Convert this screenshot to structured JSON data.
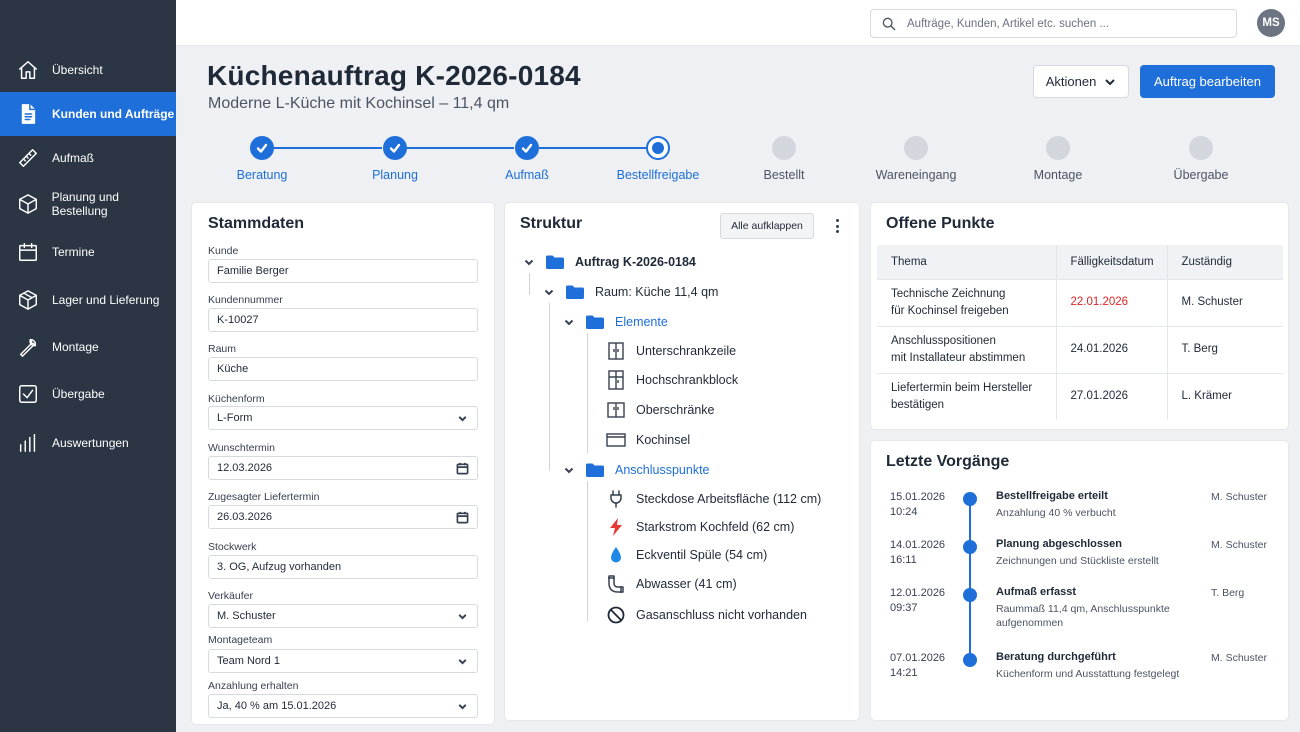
{
  "sidebar": {
    "items": [
      {
        "label": "Übersicht",
        "icon": "home-icon",
        "active": false
      },
      {
        "label": "Kunden und Aufträge",
        "icon": "document-icon",
        "active": true
      },
      {
        "label": "Aufmaß",
        "icon": "ruler-icon",
        "active": false
      },
      {
        "label": "Planung und Bestellung",
        "icon": "cube-icon",
        "active": false
      },
      {
        "label": "Termine",
        "icon": "calendar-icon",
        "active": false
      },
      {
        "label": "Lager und Lieferung",
        "icon": "box-icon",
        "active": false
      },
      {
        "label": "Montage",
        "icon": "wrench-icon",
        "active": false
      },
      {
        "label": "Übergabe",
        "icon": "checkbox-icon",
        "active": false
      },
      {
        "label": "Auswertungen",
        "icon": "bar-chart-icon",
        "active": false
      }
    ]
  },
  "topbar": {
    "search_placeholder": "Aufträge, Kunden, Artikel etc. suchen ...",
    "avatar_initials": "MS"
  },
  "header": {
    "title": "Küchenauftrag K-2026-0184",
    "subtitle": "Moderne L-Küche mit Kochinsel – 11,4 qm",
    "actions_label": "Aktionen",
    "edit_label": "Auftrag bearbeiten"
  },
  "steps": [
    {
      "label": "Beratung",
      "state": "done"
    },
    {
      "label": "Planung",
      "state": "done"
    },
    {
      "label": "Aufmaß",
      "state": "done"
    },
    {
      "label": "Bestellfreigabe",
      "state": "current"
    },
    {
      "label": "Bestellt",
      "state": "todo"
    },
    {
      "label": "Wareneingang",
      "state": "todo"
    },
    {
      "label": "Montage",
      "state": "todo"
    },
    {
      "label": "Übergabe",
      "state": "todo"
    }
  ],
  "stammdaten": {
    "title": "Stammdaten",
    "fields": [
      {
        "label": "Kunde",
        "value": "Familie Berger",
        "kind": "text"
      },
      {
        "label": "Kundennummer",
        "value": "K-10027",
        "kind": "text"
      },
      {
        "label": "Raum",
        "value": "Küche",
        "kind": "text"
      },
      {
        "label": "Küchenform",
        "value": "L-Form",
        "kind": "select"
      },
      {
        "label": "Wunschtermin",
        "value": "12.03.2026",
        "kind": "date"
      },
      {
        "label": "Zugesagter Liefertermin",
        "value": "26.03.2026",
        "kind": "date"
      },
      {
        "label": "Stockwerk",
        "value": "3. OG, Aufzug vorhanden",
        "kind": "text"
      },
      {
        "label": "Verkäufer",
        "value": "M. Schuster",
        "kind": "select"
      },
      {
        "label": "Montageteam",
        "value": "Team Nord 1",
        "kind": "select"
      },
      {
        "label": "Anzahlung erhalten",
        "value": "Ja, 40 % am 15.01.2026",
        "kind": "select"
      }
    ]
  },
  "struktur": {
    "title": "Struktur",
    "expand_label": "Alle aufklappen",
    "root": "Auftrag K-2026-0184",
    "room": "Raum: Küche 11,4 qm",
    "elemente": {
      "label": "Elemente",
      "items": [
        {
          "label": "Unterschrankzeile",
          "icon": "cabinet-icon"
        },
        {
          "label": "Hochschrankblock",
          "icon": "tall-cabinet-icon"
        },
        {
          "label": "Oberschränke",
          "icon": "wall-cabinet-icon"
        },
        {
          "label": "Kochinsel",
          "icon": "island-icon"
        }
      ]
    },
    "anschluss": {
      "label": "Anschlusspunkte",
      "items": [
        {
          "label": "Steckdose Arbeitsfläche (112 cm)",
          "icon": "plug-icon"
        },
        {
          "label": "Starkstrom Kochfeld (62 cm)",
          "icon": "lightning-icon"
        },
        {
          "label": "Eckventil Spüle (54 cm)",
          "icon": "water-drop-icon"
        },
        {
          "label": "Abwasser (41 cm)",
          "icon": "drain-pipe-icon"
        },
        {
          "label": "Gasanschluss nicht vorhanden",
          "icon": "prohibited-icon"
        }
      ]
    }
  },
  "offene_punkte": {
    "title": "Offene Punkte",
    "columns": [
      "Thema",
      "Fälligkeitsdatum",
      "Zuständig"
    ],
    "rows": [
      {
        "thema_1": "Technische Zeichnung",
        "thema_2": "für Kochinsel freigeben",
        "datum": "22.01.2026",
        "zustaendig": "M. Schuster",
        "overdue": true
      },
      {
        "thema_1": "Anschlusspositionen",
        "thema_2": "mit Installateur abstimmen",
        "datum": "24.01.2026",
        "zustaendig": "T. Berg",
        "overdue": false
      },
      {
        "thema_1": "Liefertermin beim Hersteller",
        "thema_2": "bestätigen",
        "datum": "27.01.2026",
        "zustaendig": "L. Krämer",
        "overdue": false
      }
    ]
  },
  "letzte_vorgaenge": {
    "title": "Letzte Vorgänge",
    "items": [
      {
        "date": "15.01.2026",
        "time": "10:24",
        "title": "Bestellfreigabe erteilt",
        "desc": "Anzahlung 40 % verbucht",
        "user": "M. Schuster"
      },
      {
        "date": "14.01.2026",
        "time": "16:11",
        "title": "Planung abgeschlossen",
        "desc": "Zeichnungen und Stückliste erstellt",
        "user": "M. Schuster"
      },
      {
        "date": "12.01.2026",
        "time": "09:37",
        "title": "Aufmaß erfasst",
        "desc": "Raummaß 11,4 qm, Anschlusspunkte aufgenommen",
        "user": "T. Berg"
      },
      {
        "date": "07.01.2026",
        "time": "14:21",
        "title": "Beratung durchgeführt",
        "desc": "Küchenform und Ausstattung festgelegt",
        "user": "M. Schuster"
      }
    ]
  },
  "colors": {
    "accent": "#1e6fd9",
    "sidebar": "#2b3543",
    "overdue": "#dc2626"
  }
}
